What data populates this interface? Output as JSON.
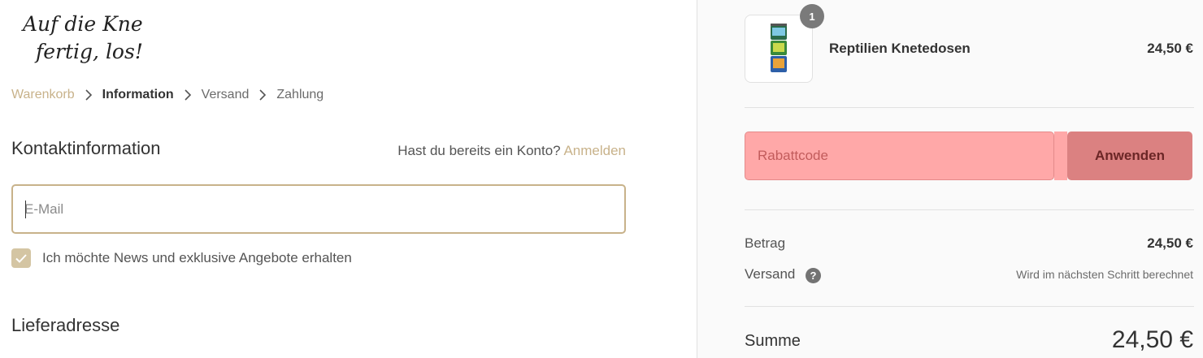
{
  "logo": {
    "line1": "Auf die Knete,",
    "line2": "fertig, los!"
  },
  "breadcrumb": {
    "items": [
      "Warenkorb",
      "Information",
      "Versand",
      "Zahlung"
    ]
  },
  "contact": {
    "title": "Kontaktinformation",
    "account_prompt": "Hast du bereits ein Konto?",
    "login_link": "Anmelden",
    "email_placeholder": "E-Mail",
    "newsletter_label": "Ich möchte News und exklusive Angebote erhalten",
    "newsletter_checked": true
  },
  "shipping": {
    "title": "Lieferadresse"
  },
  "order": {
    "item": {
      "name": "Reptilien Knetedosen",
      "price": "24,50 €",
      "quantity": "1"
    },
    "discount_placeholder": "Rabattcode",
    "apply_label": "Anwenden",
    "subtotal_label": "Betrag",
    "subtotal_value": "24,50 €",
    "shipping_label": "Versand",
    "shipping_note": "Wird im nächsten Schritt berechnet",
    "total_label": "Summe",
    "total_value": "24,50 €"
  },
  "colors": {
    "accent": "#c8b28a",
    "discount_bg": "#ffa8a8",
    "apply_bg": "#db8181"
  }
}
